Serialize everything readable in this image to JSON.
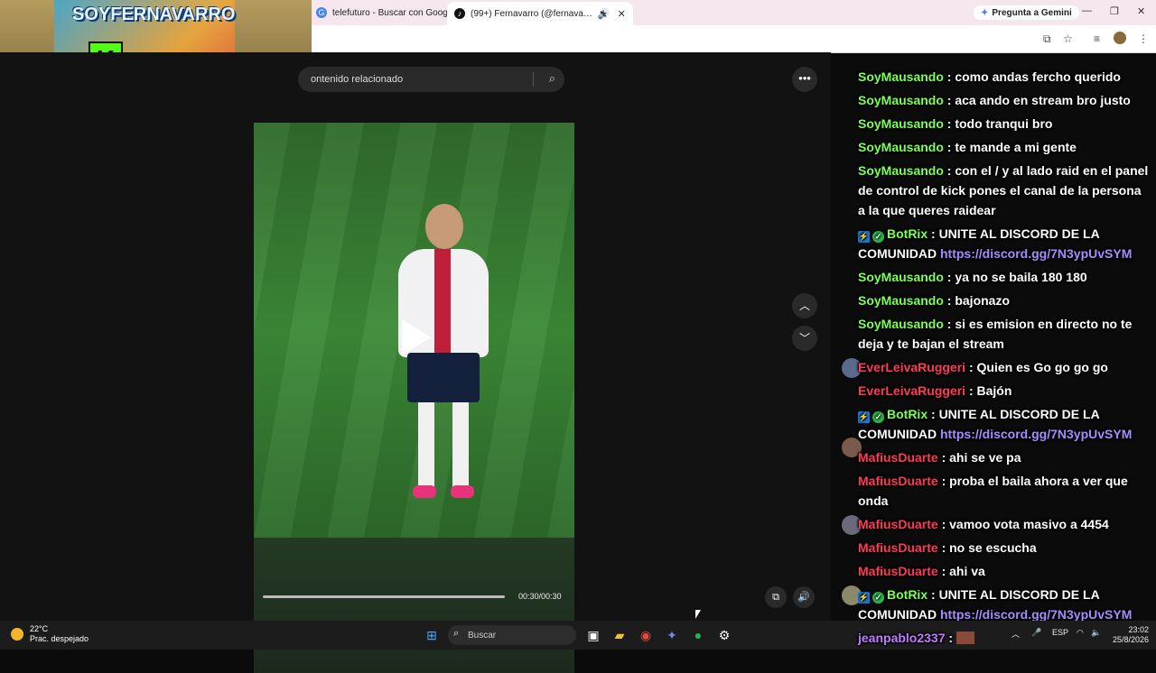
{
  "browser": {
    "tabs": [
      {
        "label": "telefuturo - Buscar con Google",
        "icon": "google-icon"
      },
      {
        "label": "(99+) Fernavarro (@fernava…",
        "icon": "tiktok-icon"
      }
    ],
    "gemini_label": "Pregunta a Gemini",
    "new_tab": "+",
    "window": {
      "minimize": "—",
      "restore": "❐",
      "close": "✕"
    }
  },
  "tiktok": {
    "search_placeholder": "ontenido relacionado",
    "more": "•••",
    "nav_up": "︿",
    "nav_down": "﹀",
    "timecode": "00:30/00:30",
    "progress": 1.0
  },
  "webcam": {
    "logo": "SOYFERNAVARRO",
    "badge": "K"
  },
  "chat": {
    "messages": [
      {
        "user": "SoyMausando",
        "user_color": "green",
        "text": " : como andas fercho querido"
      },
      {
        "user": "SoyMausando",
        "user_color": "green",
        "text": " : aca ando en stream bro justo"
      },
      {
        "user": "SoyMausando",
        "user_color": "green",
        "text": " : todo tranqui bro"
      },
      {
        "user": "SoyMausando",
        "user_color": "green",
        "text": " : te mande a mi gente"
      },
      {
        "user": "SoyMausando",
        "user_color": "green",
        "text": " : con el / y al lado raid en el panel de control de kick pones el canal de la persona a la que queres raidear"
      },
      {
        "user": "BotRix",
        "user_color": "green",
        "bot": true,
        "text": " : UNITE AL DISCORD DE LA COMUNIDAD ",
        "link": "https://discord.gg/7N3ypUvSYM"
      },
      {
        "user": "SoyMausando",
        "user_color": "green",
        "text": " : ya no se baila 180 180"
      },
      {
        "user": "SoyMausando",
        "user_color": "green",
        "text": " : bajonazo"
      },
      {
        "user": "SoyMausando",
        "user_color": "green",
        "text": " : si es emision en directo no te deja y te bajan el stream"
      },
      {
        "user": "EverLeivaRuggeri",
        "user_color": "red",
        "text": " : Quien es Go go go go"
      },
      {
        "user": "EverLeivaRuggeri",
        "user_color": "red",
        "text": " : Bajón"
      },
      {
        "user": "BotRix",
        "user_color": "green",
        "bot": true,
        "text": " : UNITE AL DISCORD DE LA COMUNIDAD ",
        "link": "https://discord.gg/7N3ypUvSYM"
      },
      {
        "user": "MafiusDuarte",
        "user_color": "red",
        "text": " : ahi se ve pa"
      },
      {
        "user": "MafiusDuarte",
        "user_color": "red",
        "text": " : proba el baila ahora a ver que onda"
      },
      {
        "user": "MafiusDuarte",
        "user_color": "red",
        "text": " : vamoo vota masivo a 4454"
      },
      {
        "user": "MafiusDuarte",
        "user_color": "red",
        "text": " : no se escucha"
      },
      {
        "user": "MafiusDuarte",
        "user_color": "red",
        "text": " : ahi va"
      },
      {
        "user": "BotRix",
        "user_color": "green",
        "bot": true,
        "text": " : UNITE AL DISCORD DE LA COMUNIDAD ",
        "link": "https://discord.gg/7N3ypUvSYM"
      },
      {
        "user": "jeanpablo2337",
        "user_color": "purple",
        "text": " :"
      }
    ]
  },
  "taskbar": {
    "weather_temp": "22°C",
    "weather_desc": "Prac. despejado",
    "search_placeholder": "Buscar",
    "lang": "ESP",
    "time": "23:02",
    "date": "25/8/2026"
  }
}
